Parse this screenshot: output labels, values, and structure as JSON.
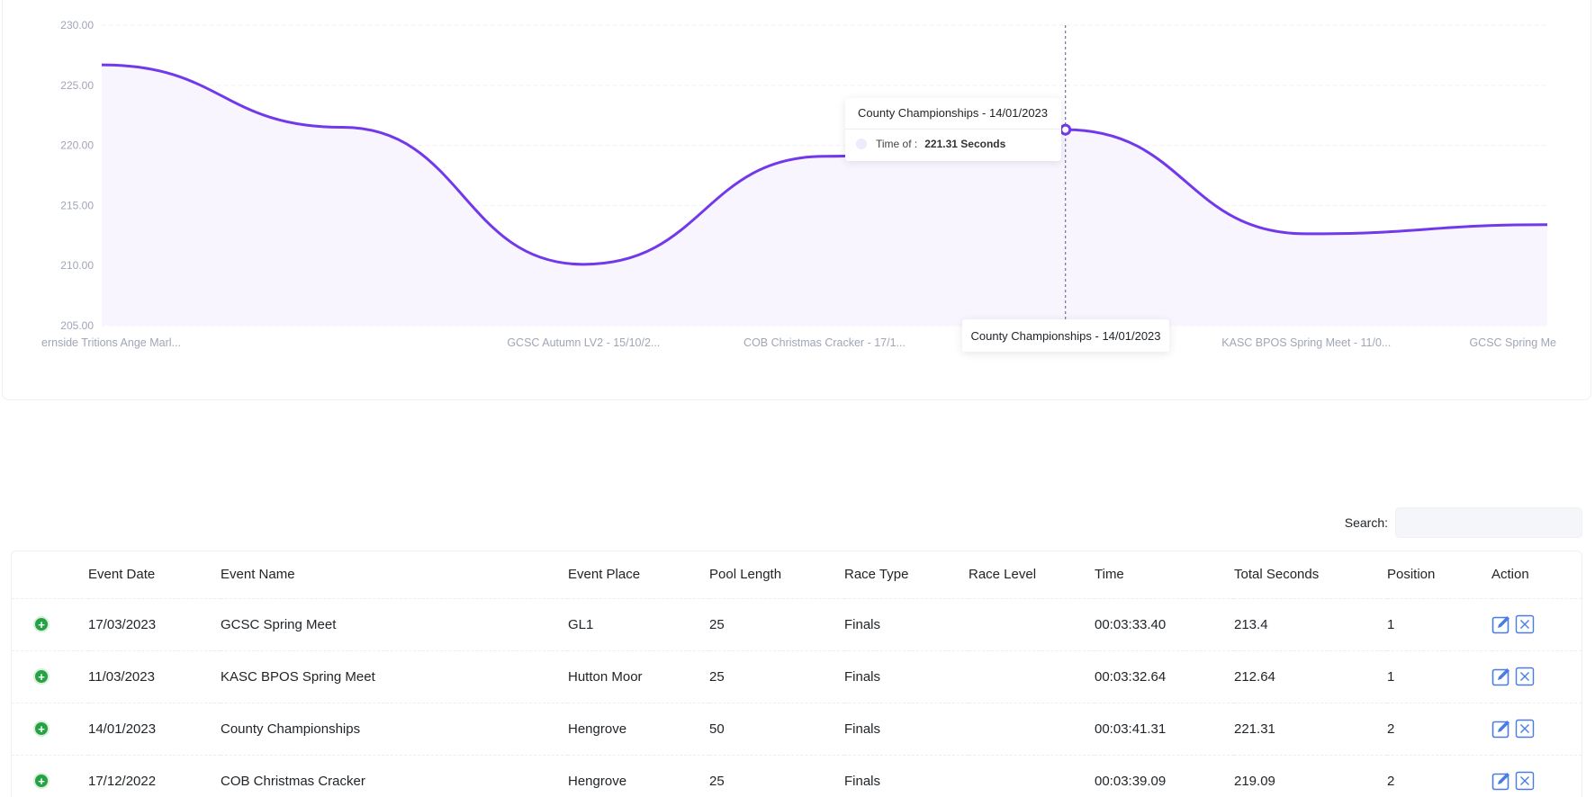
{
  "chart_data": {
    "type": "area",
    "categories": [
      "ernside Tritions Ange Marl...",
      "",
      "GCSC Autumn LV2 - 15/10/2...",
      "COB Christmas Cracker - 17/1...",
      "County Championships - 14/0...",
      "KASC BPOS Spring Meet - 11/0...",
      "GCSC Spring Me"
    ],
    "values": [
      226.7,
      221.5,
      210.1,
      219.09,
      221.31,
      212.64,
      213.4
    ],
    "ylim": [
      205,
      230
    ],
    "yticks": [
      "205.00",
      "210.00",
      "215.00",
      "220.00",
      "225.00",
      "230.00"
    ],
    "grid": true,
    "line_color": "#7239ea",
    "fill_color": "#f8f5ff",
    "active_index": 4
  },
  "tooltip": {
    "title": "County Championships - 14/01/2023",
    "label": "Time of :",
    "value": "221.31 Seconds"
  },
  "xaxis_tooltip": "County Championships - 14/01/2023",
  "search": {
    "label": "Search:",
    "value": ""
  },
  "table": {
    "headers": {
      "date": "Event Date",
      "name": "Event Name",
      "place": "Event Place",
      "pool": "Pool Length",
      "type": "Race Type",
      "level": "Race Level",
      "time": "Time",
      "total": "Total Seconds",
      "position": "Position",
      "action": "Action"
    },
    "rows": [
      {
        "date": "17/03/2023",
        "name": "GCSC Spring Meet",
        "place": "GL1",
        "pool": "25",
        "type": "Finals",
        "level": "",
        "time": "00:03:33.40",
        "total": "213.4",
        "position": "1"
      },
      {
        "date": "11/03/2023",
        "name": "KASC BPOS Spring Meet",
        "place": "Hutton Moor",
        "pool": "25",
        "type": "Finals",
        "level": "",
        "time": "00:03:32.64",
        "total": "212.64",
        "position": "1"
      },
      {
        "date": "14/01/2023",
        "name": "County Championships",
        "place": "Hengrove",
        "pool": "50",
        "type": "Finals",
        "level": "",
        "time": "00:03:41.31",
        "total": "221.31",
        "position": "2"
      },
      {
        "date": "17/12/2022",
        "name": "COB Christmas Cracker",
        "place": "Hengrove",
        "pool": "25",
        "type": "Finals",
        "level": "",
        "time": "00:03:39.09",
        "total": "219.09",
        "position": "2"
      }
    ]
  }
}
